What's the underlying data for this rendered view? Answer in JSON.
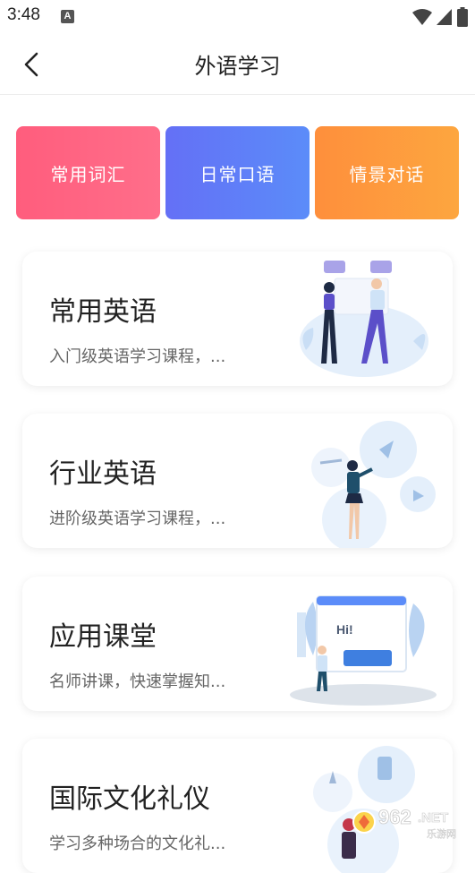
{
  "status_bar": {
    "time": "3:48",
    "notif_icon_letter": "A"
  },
  "header": {
    "title": "外语学习"
  },
  "tiles": [
    {
      "label": "常用词汇"
    },
    {
      "label": "日常口语"
    },
    {
      "label": "情景对话"
    }
  ],
  "cards": [
    {
      "title": "常用英语",
      "desc": "入门级英语学习课程，..."
    },
    {
      "title": "行业英语",
      "desc": "进阶级英语学习课程，..."
    },
    {
      "title": "应用课堂",
      "desc": "名师讲课，快速掌握知..."
    },
    {
      "title": "国际文化礼仪",
      "desc": "学习多种场合的文化礼..."
    }
  ],
  "illustration_texts": {
    "hi": "Hi!"
  },
  "watermark": {
    "main": "962",
    "suffix": ".NET",
    "sub": "乐游网"
  },
  "colors": {
    "tile_red": "#ff6584",
    "tile_blue": "#5f7ef8",
    "tile_orange": "#fd9a3d",
    "illus_blue": "#cfe3f7",
    "illus_purple": "#5b4fc9"
  }
}
